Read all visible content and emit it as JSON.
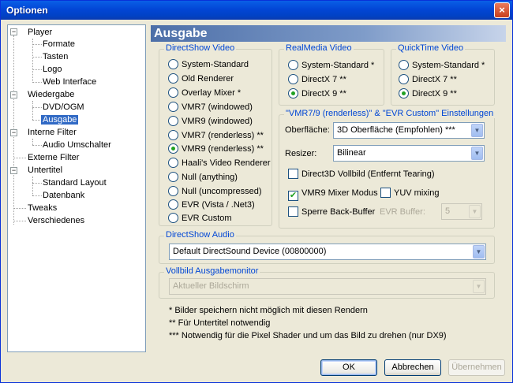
{
  "window": {
    "title": "Optionen",
    "close_glyph": "×"
  },
  "tree": {
    "player": "Player",
    "formate": "Formate",
    "tasten": "Tasten",
    "logo": "Logo",
    "web_interface": "Web Interface",
    "wiedergabe": "Wiedergabe",
    "dvd_ogm": "DVD/OGM",
    "ausgabe": "Ausgabe",
    "interne_filter": "Interne Filter",
    "audio_umschalter": "Audio Umschalter",
    "externe_filter": "Externe Filter",
    "untertitel": "Untertitel",
    "standard_layout": "Standard Layout",
    "datenbank": "Datenbank",
    "tweaks": "Tweaks",
    "verschiedenes": "Verschiedenes",
    "expander_glyph": "−"
  },
  "header": {
    "title": "Ausgabe"
  },
  "directshow_video": {
    "label": "DirectShow Video",
    "options": [
      "System-Standard",
      "Old Renderer",
      "Overlay Mixer *",
      "VMR7 (windowed)",
      "VMR9 (windowed)",
      "VMR7 (renderless) **",
      "VMR9 (renderless) **",
      "Haali's Video Renderer",
      "Null (anything)",
      "Null (uncompressed)",
      "EVR (Vista / .Net3)",
      "EVR Custom"
    ],
    "selected": "VMR9 (renderless) **"
  },
  "realmedia_video": {
    "label": "RealMedia Video",
    "options": [
      "System-Standard *",
      "DirectX 7 **",
      "DirectX 9 **"
    ],
    "selected": "DirectX 9 **"
  },
  "quicktime_video": {
    "label": "QuickTime Video",
    "options": [
      "System-Standard *",
      "DirectX 7 **",
      "DirectX 9 **"
    ],
    "selected": "DirectX 9 **"
  },
  "vmr_settings": {
    "label": "\"VMR7/9 (renderless)\" & \"EVR Custom\" Einstellungen",
    "surface_label": "Oberfläche:",
    "surface_value": "3D Oberfläche (Empfohlen) ***",
    "resizer_label": "Resizer:",
    "resizer_value": "Bilinear",
    "d3d_fullscreen": {
      "label": "Direct3D Vollbild (Entfernt Tearing)",
      "checked": false
    },
    "vmr9_mixer": {
      "label": "VMR9 Mixer Modus",
      "checked": true
    },
    "yuv_mixing": {
      "label": "YUV mixing",
      "checked": false
    },
    "lock_back_buffer": {
      "label": "Sperre Back-Buffer",
      "checked": false
    },
    "evr_buffer_label": "EVR Buffer:",
    "evr_buffer_value": "5",
    "check_glyph": "✔"
  },
  "directshow_audio": {
    "label": "DirectShow Audio",
    "device": "Default DirectSound Device (00800000)"
  },
  "fullscreen_monitor": {
    "label": "Vollbild Ausgabemonitor",
    "value": "Aktueller Bildschirm"
  },
  "notes": [
    "* Bilder speichern nicht möglich mit diesen Rendern",
    "** Für Untertitel notwendig",
    "*** Notwendig für die Pixel Shader und um das Bild zu drehen (nur DX9)"
  ],
  "buttons": {
    "ok": "OK",
    "cancel": "Abbrechen",
    "apply": "Übernehmen"
  },
  "dropdown_glyph": "▼"
}
